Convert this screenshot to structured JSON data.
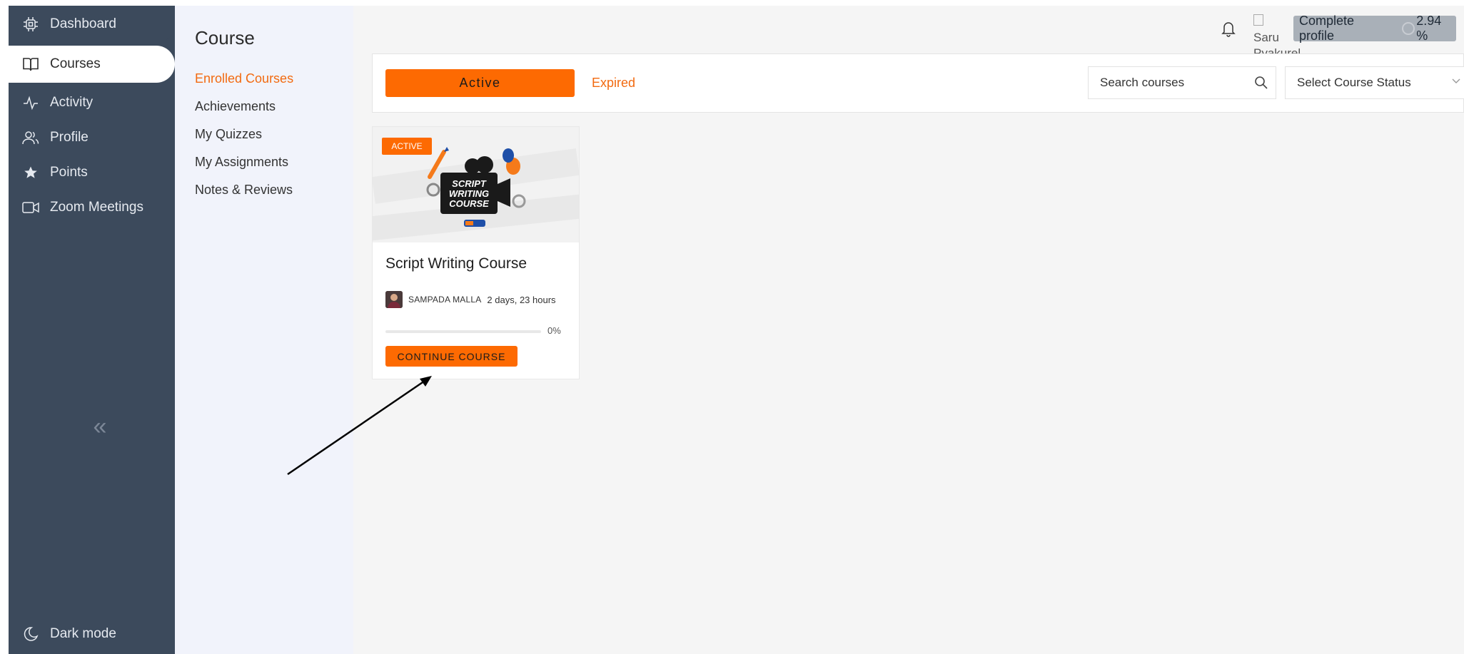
{
  "sidebar": {
    "items": [
      {
        "label": "Dashboard",
        "icon": "cpu-chip-icon"
      },
      {
        "label": "Courses",
        "icon": "open-book-icon"
      },
      {
        "label": "Activity",
        "icon": "activity-pulse-icon"
      },
      {
        "label": "Profile",
        "icon": "users-icon"
      },
      {
        "label": "Points",
        "icon": "star-icon"
      },
      {
        "label": "Zoom Meetings",
        "icon": "video-camera-icon"
      }
    ],
    "collapse_glyph": "«",
    "dark_mode_label": "Dark mode"
  },
  "course_menu": {
    "title": "Course",
    "items": [
      {
        "label": "Enrolled Courses",
        "active": true
      },
      {
        "label": "Achievements"
      },
      {
        "label": "My Quizzes"
      },
      {
        "label": "My Assignments"
      },
      {
        "label": "Notes & Reviews"
      }
    ]
  },
  "header": {
    "avatar_alt_line1": "Saru",
    "avatar_alt_line2": "Pyakurel",
    "complete_profile_label": "Complete profile",
    "complete_profile_percent": "2.94 %"
  },
  "filters": {
    "tab_active": "Active",
    "tab_expired": "Expired",
    "search_placeholder": "Search courses",
    "status_select": "Select Course Status"
  },
  "course_card": {
    "badge": "ACTIVE",
    "thumbnail_line1": "SCRIPT",
    "thumbnail_line2": "WRITING",
    "thumbnail_line3": "COURSE",
    "title": "Script Writing Course",
    "instructor": "SAMPADA MALLA",
    "duration": "2 days, 23 hours",
    "progress_fraction": 0,
    "progress_label": "0%",
    "continue_label": "CONTINUE COURSE"
  },
  "colors": {
    "sidebar_bg": "#3c4a5c",
    "accent": "#fd6a02",
    "submenu_bg": "#f1f3fb"
  }
}
